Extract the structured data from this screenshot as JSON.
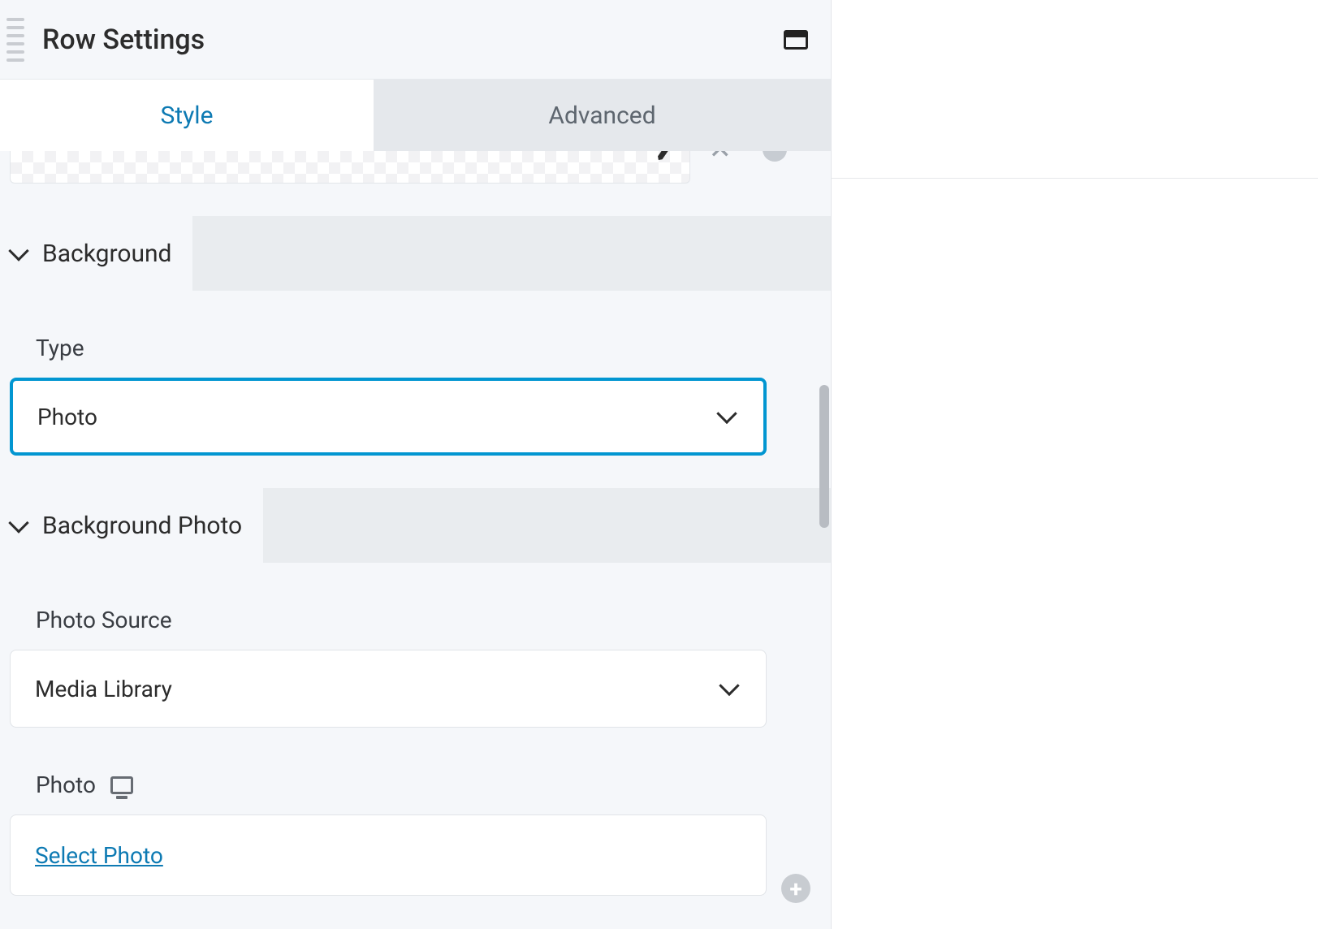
{
  "header": {
    "title": "Row Settings"
  },
  "tabs": {
    "style": "Style",
    "advanced": "Advanced"
  },
  "sections": {
    "background": {
      "title": "Background",
      "type_label": "Type",
      "type_value": "Photo"
    },
    "background_photo": {
      "title": "Background Photo",
      "source_label": "Photo Source",
      "source_value": "Media Library",
      "photo_label": "Photo",
      "select_photo": "Select Photo"
    }
  }
}
